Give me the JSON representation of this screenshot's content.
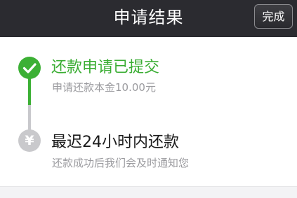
{
  "header": {
    "title": "申请结果",
    "done_label": "完成"
  },
  "steps": [
    {
      "title": "还款申请已提交",
      "subtitle": "申请还款本金10.00元",
      "icon": "check-icon",
      "status": "completed",
      "color": "#3cb035"
    },
    {
      "title": "最迟24小时内还款",
      "subtitle": "还款成功后我们会及时通知您",
      "icon": "yen-icon",
      "icon_glyph": "¥",
      "status": "pending",
      "color": "#c9c9cc"
    }
  ],
  "colors": {
    "navbar": "#2b2b30",
    "accent_green": "#3cb035",
    "inactive_gray": "#c9c9cc"
  }
}
